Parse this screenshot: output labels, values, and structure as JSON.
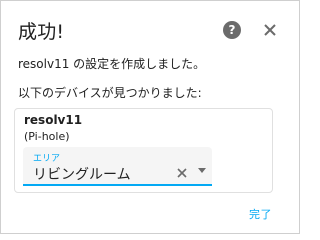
{
  "dialog": {
    "title": "成功!",
    "help_icon": "question-circle-icon",
    "close_icon": "close-x-icon",
    "message_created": "resolv11 の設定を作成しました。",
    "message_found": "以下のデバイスが見つかりました:",
    "finish_label": "完了"
  },
  "device": {
    "name": "resolv11",
    "model": "(Pi-hole)",
    "area_field": {
      "label": "エリア",
      "value": "リビングルーム",
      "clear_icon": "clear-x-icon",
      "dropdown_icon": "dropdown-arrow-icon"
    }
  },
  "colors": {
    "accent": "#03a9f4",
    "icon": "#6b6b6b"
  }
}
